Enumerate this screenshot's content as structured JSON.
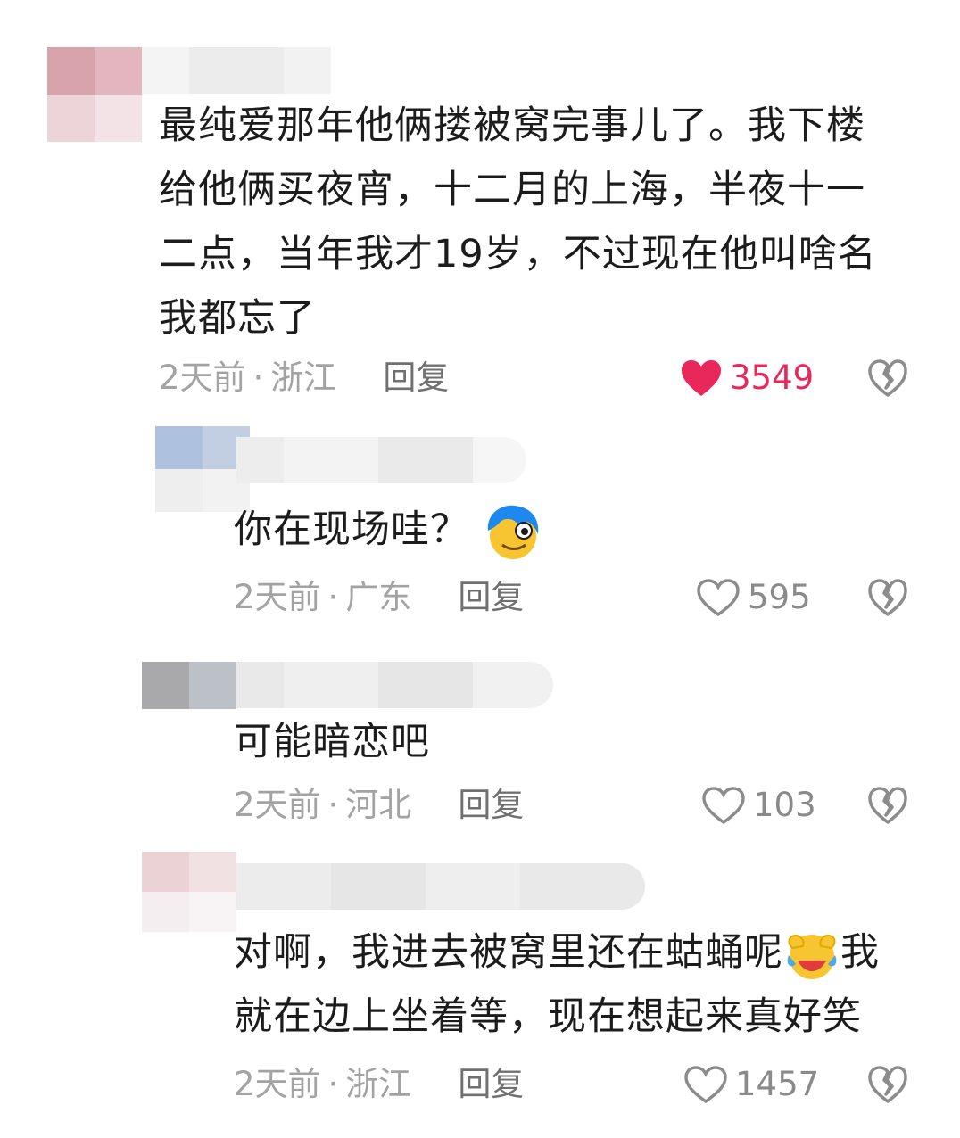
{
  "comments": [
    {
      "text": "最纯爱那年他俩搂被窝完事儿了。我下楼给他俩买夜宵，十二月的上海，半夜十一二点，当年我才19岁，不过现在他叫啥名我都忘了",
      "line1": "最纯爱那年他俩搂被窝完事儿了。我下楼",
      "line2": "给他俩买夜宵，十二月的上海，半夜十一",
      "line3": "二点，当年我才19岁，不过现在他叫啥名",
      "line4": "我都忘了",
      "time": "2天前",
      "location": "浙江",
      "reply": "回复",
      "likes": "3549",
      "liked": true
    },
    {
      "text": "你在现场哇？",
      "emoji": "star-eyed-face-icon",
      "time": "2天前",
      "location": "广东",
      "reply": "回复",
      "likes": "595",
      "liked": false
    },
    {
      "text": "可能暗恋吧",
      "time": "2天前",
      "location": "河北",
      "reply": "回复",
      "likes": "103",
      "liked": false
    },
    {
      "text_part1": "对啊，我进去被窝里还在蛄蛹呢",
      "emoji": "laughing-crying-face-icon",
      "text_part2": "我",
      "line2": "就在边上坐着等，现在想起来真好笑",
      "time": "2天前",
      "location": "浙江",
      "reply": "回复",
      "likes": "1457",
      "liked": false
    }
  ],
  "separator": "·",
  "colors": {
    "liked": "#e8285b",
    "meta": "#a3a3a3",
    "text": "#1c1c1c"
  }
}
